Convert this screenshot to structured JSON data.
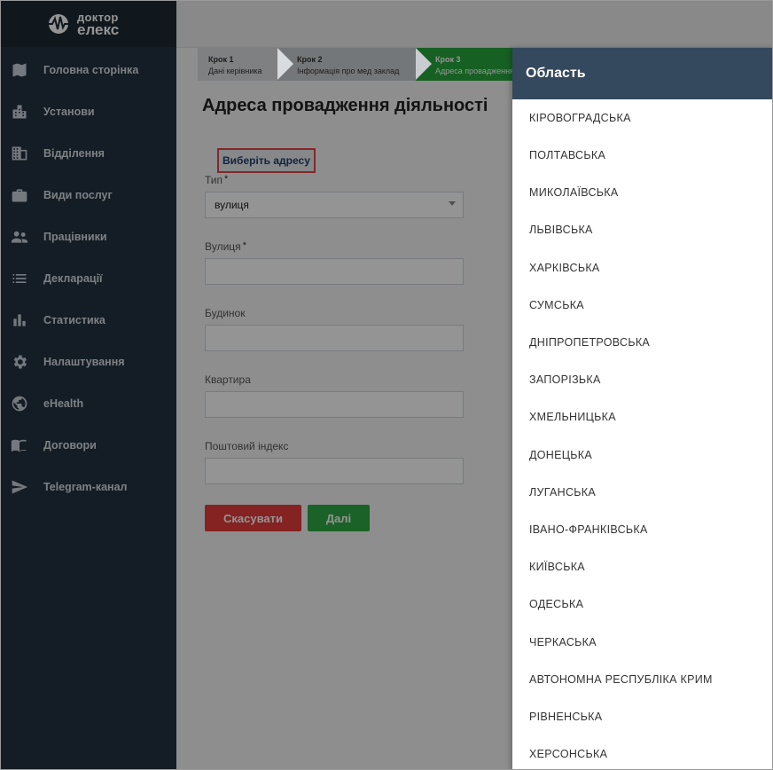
{
  "logo": {
    "line1": "доктор",
    "line2": "елекс"
  },
  "sidebar": {
    "items": [
      {
        "label": "Головна сторінка",
        "icon": "map-icon"
      },
      {
        "label": "Установи",
        "icon": "building-icon"
      },
      {
        "label": "Відділення",
        "icon": "grid-building-icon"
      },
      {
        "label": "Види послуг",
        "icon": "briefcase-icon"
      },
      {
        "label": "Працівники",
        "icon": "people-icon"
      },
      {
        "label": "Декларації",
        "icon": "list-icon"
      },
      {
        "label": "Статистика",
        "icon": "bar-chart-icon"
      },
      {
        "label": "Налаштування",
        "icon": "gear-icon"
      },
      {
        "label": "eHealth",
        "icon": "globe-icon"
      },
      {
        "label": "Договори",
        "icon": "book-icon"
      },
      {
        "label": "Telegram-канал",
        "icon": "send-icon"
      }
    ]
  },
  "steps": [
    {
      "title": "Крок 1",
      "subtitle": "Дані керівника"
    },
    {
      "title": "Крок 2",
      "subtitle": "Інформація про мед заклад"
    },
    {
      "title": "Крок 3",
      "subtitle": "Адреса провадження"
    }
  ],
  "form": {
    "title": "Адреса провадження діяльності",
    "choose_address": "Виберіть адресу",
    "type_label": "Тип",
    "type_value": "вулиця",
    "street_label": "Вулиця",
    "house_label": "Будинок",
    "apartment_label": "Квартира",
    "postal_label": "Поштовий індекс",
    "required_mark": "*",
    "cancel_label": "Скасувати",
    "next_label": "Далі"
  },
  "drawer": {
    "title": "Область",
    "regions": [
      "КІРОВОГРАДСЬКА",
      "ПОЛТАВСЬКА",
      "МИКОЛАЇВСЬКА",
      "ЛЬВІВСЬКА",
      "ХАРКІВСЬКА",
      "СУМСЬКА",
      "ДНІПРОПЕТРОВСЬКА",
      "ЗАПОРІЗЬКА",
      "ХМЕЛЬНИЦЬКА",
      "ДОНЕЦЬКА",
      "ЛУГАНСЬКА",
      "ІВАНО-ФРАНКІВСЬКА",
      "КИЇВСЬКА",
      "ОДЕСЬКА",
      "ЧЕРКАСЬКА",
      "АВТОНОМНА РЕСПУБЛІКА КРИМ",
      "РІВНЕНСЬКА",
      "ХЕРСОНСЬКА"
    ]
  },
  "colors": {
    "sidebar_bg": "#243240",
    "drawer_header": "#34495e",
    "active_step": "#27a53d",
    "cancel": "#e53b3b",
    "next": "#2eaa44",
    "highlight_border": "#e04848"
  }
}
